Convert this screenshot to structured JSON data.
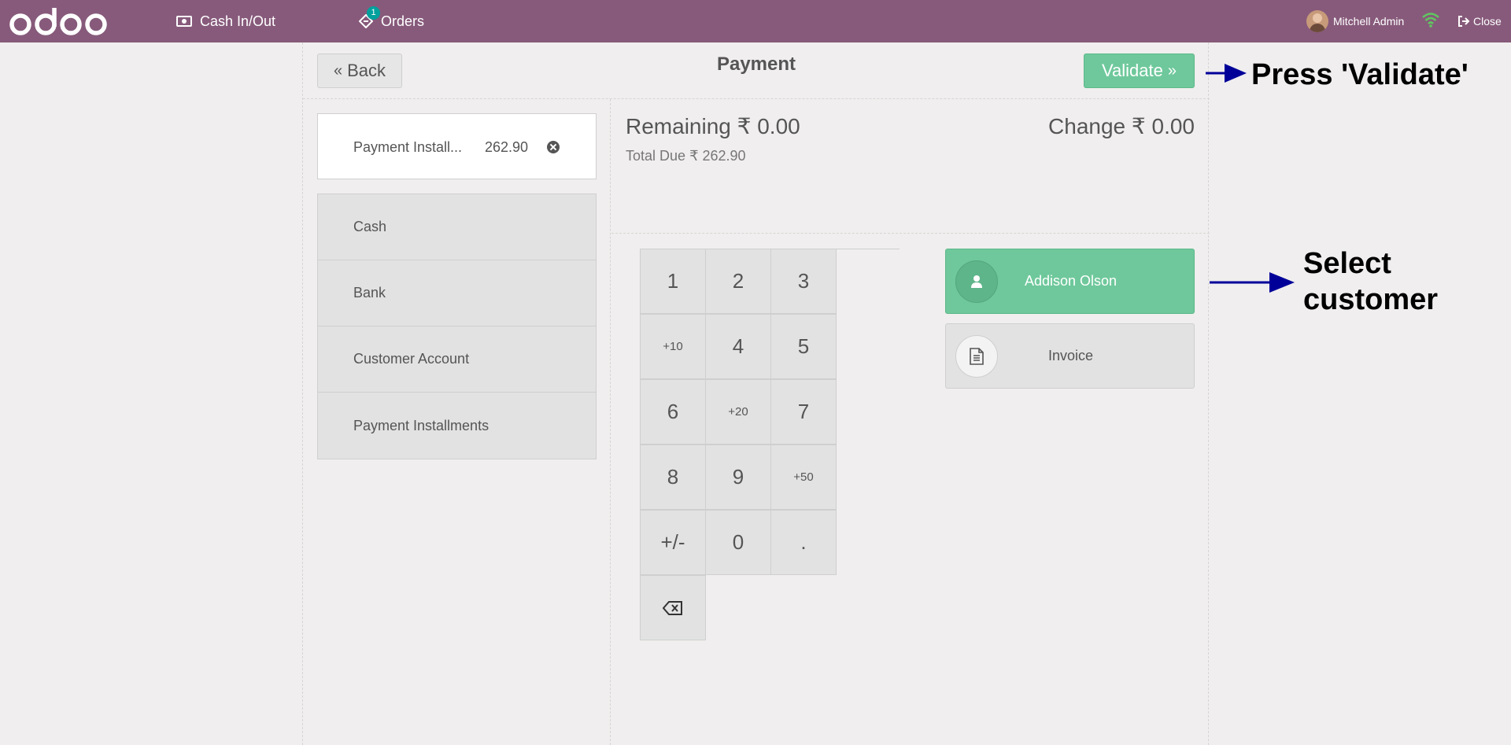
{
  "topbar": {
    "logo_text": "odoo",
    "cash_label": "Cash In/Out",
    "orders_label": "Orders",
    "orders_badge": "1",
    "user_name": "Mitchell Admin",
    "close_label": "Close"
  },
  "header": {
    "back_label": "Back",
    "title": "Payment",
    "validate_label": "Validate"
  },
  "paylines": [
    {
      "name": "Payment Install...",
      "amount": "262.90"
    }
  ],
  "methods": [
    "Cash",
    "Bank",
    "Customer Account",
    "Payment Installments"
  ],
  "summary": {
    "remaining_label": "Remaining",
    "remaining_value": "₹ 0.00",
    "change_label": "Change",
    "change_value": "₹ 0.00",
    "total_due_label": "Total Due",
    "total_due_value": "₹ 262.90"
  },
  "numpad": [
    "1",
    "2",
    "3",
    "+10",
    "4",
    "5",
    "6",
    "+20",
    "7",
    "8",
    "9",
    "+50",
    "+/-",
    "0",
    "."
  ],
  "customer": {
    "name": "Addison Olson"
  },
  "invoice": {
    "label": "Invoice"
  },
  "annotations": {
    "validate_hint": "Press 'Validate'",
    "customer_hint_line1": "Select",
    "customer_hint_line2": "customer"
  },
  "colors": {
    "navbar": "#875a7b",
    "validate": "#6ec89b",
    "badge": "#00a09d",
    "arrow": "#000099"
  },
  "icons": {
    "cash": "money-icon",
    "orders": "ticket-icon",
    "wifi": "wifi-icon",
    "close": "sign-out-icon",
    "delete": "times-circle-icon",
    "backspace": "backspace-icon",
    "customer": "user-icon",
    "invoice": "file-text-icon"
  }
}
